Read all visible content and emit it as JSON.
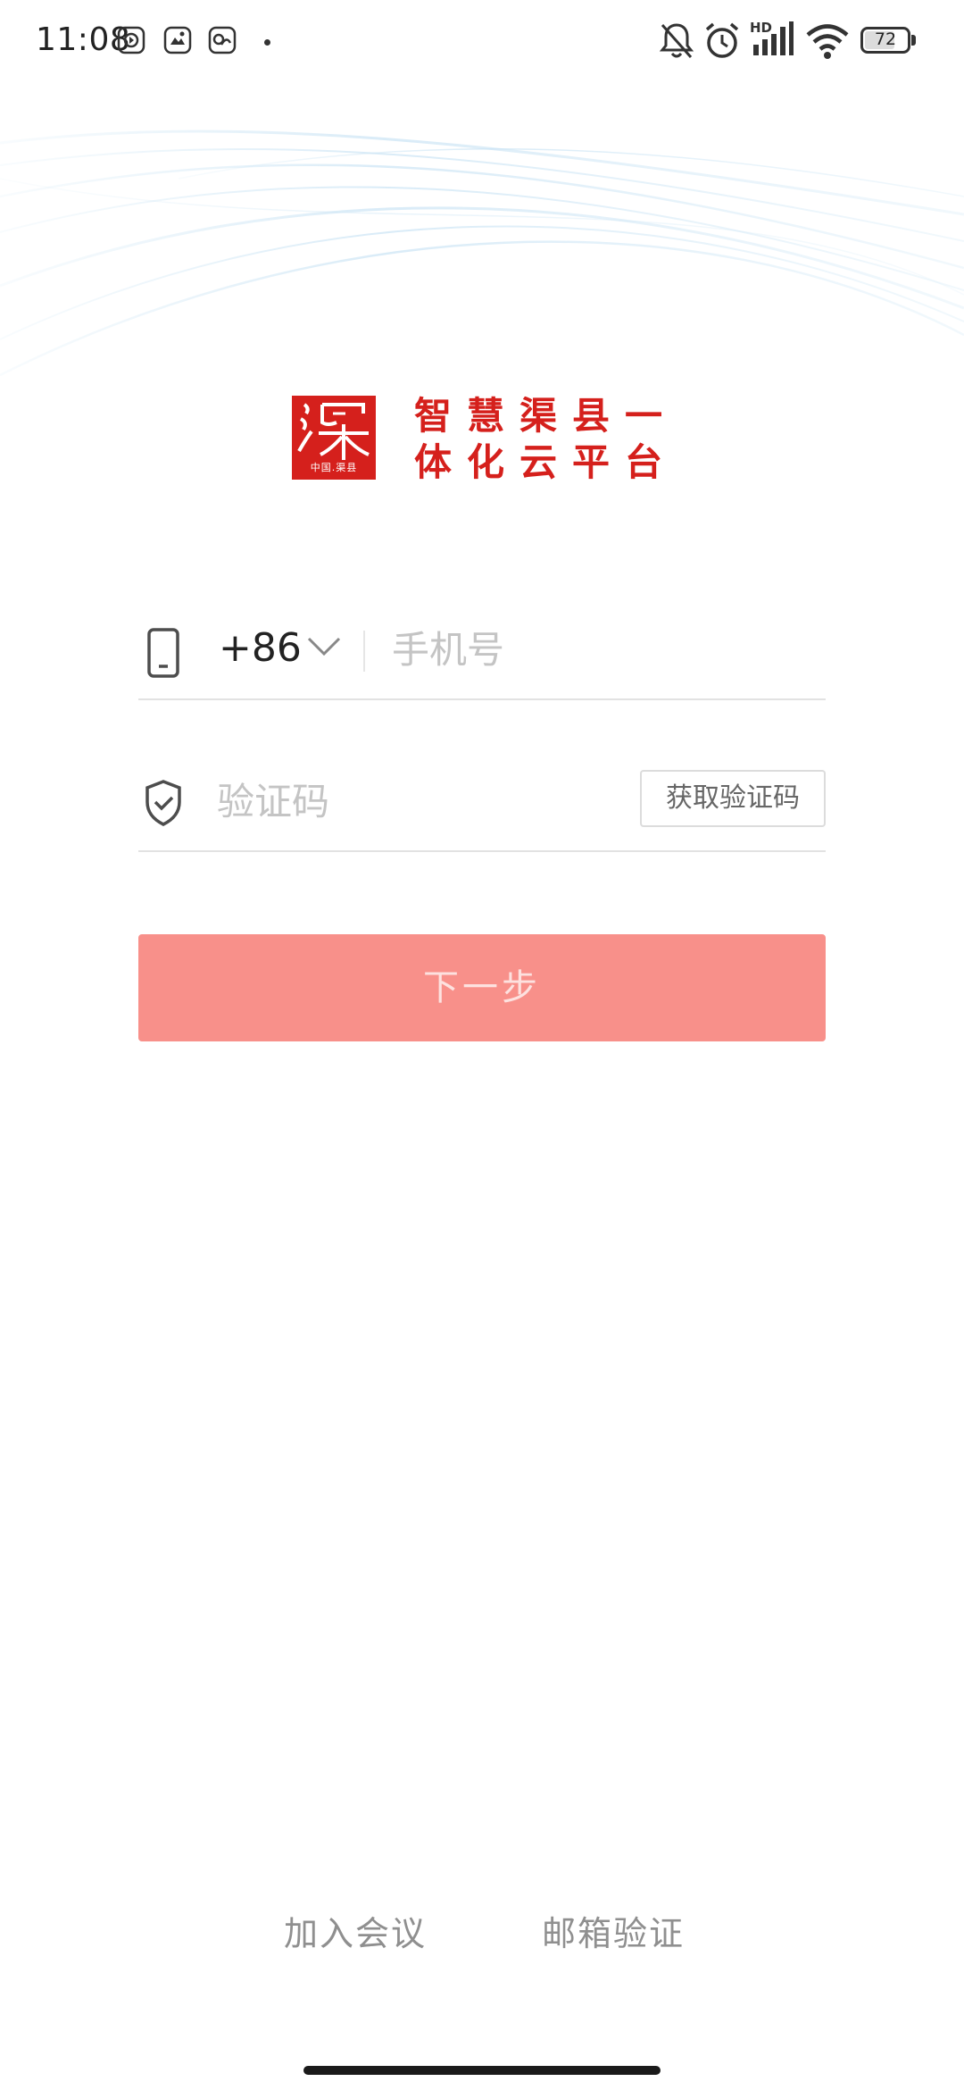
{
  "status_bar": {
    "time": "11:08",
    "left_icons": [
      "app-notification-icon",
      "app-notification-icon",
      "app-notification-icon"
    ],
    "right_icons": [
      "mute-bell-icon",
      "alarm-icon",
      "hd-signal-icon",
      "wifi-icon",
      "battery-icon"
    ],
    "signal_badge": "HD",
    "battery_level": "72"
  },
  "logo": {
    "seal_text": "渠",
    "seal_subtext": "中国.渠县",
    "title": "智慧渠县一体化云平台",
    "brand_color": "#d5201c"
  },
  "form": {
    "country_code": "+86",
    "phone_placeholder": "手机号",
    "phone_value": "",
    "code_placeholder": "验证码",
    "code_value": "",
    "get_code_label": "获取验证码",
    "next_label": "下一步",
    "next_button_color": "#f8908a"
  },
  "footer": {
    "join_meeting": "加入会议",
    "email_verify": "邮箱验证"
  }
}
